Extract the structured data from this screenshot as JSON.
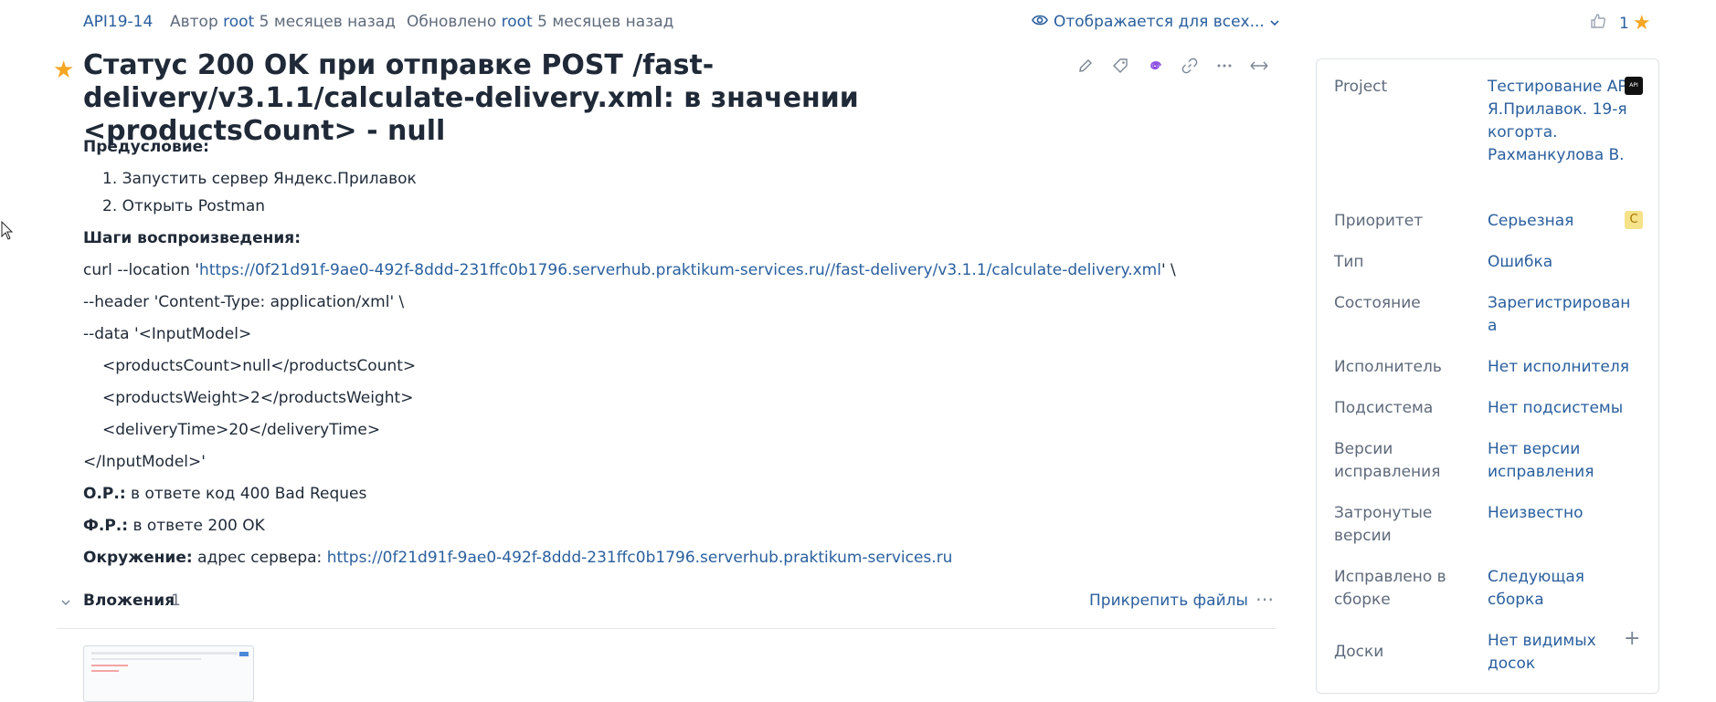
{
  "header": {
    "issue_id": "API19-14",
    "author_prefix": "Автор",
    "author_name": "root",
    "created_time": "5 месяцев назад",
    "updated_prefix": "Обновлено",
    "updated_name": "root",
    "updated_time": "5 месяцев назад",
    "visibility_label": "Отображается для всех...",
    "vote_count": "1"
  },
  "issue": {
    "title": "Статус 200 OK при отправке POST /fast-delivery/v3.1.1/calculate-delivery.xml: в значении <productsCount> - null"
  },
  "description": {
    "precondition_label": "Предусловие:",
    "precondition_steps": [
      "Запустить сервер Яндекс.Прилавок",
      "Открыть Postman"
    ],
    "steps_label": "Шаги воспроизведения:",
    "curl_prefix": "curl --location '",
    "curl_url": "https://0f21d91f-9ae0-492f-8ddd-231ffc0b1796.serverhub.praktikum-services.ru//fast-delivery/v3.1.1/calculate-delivery.xml",
    "curl_suffix": "' \\",
    "header_line": "--header 'Content-Type: application/xml' \\",
    "data_line": "--data '<InputModel>",
    "xml_line1": "<productsCount>null</productsCount>",
    "xml_line2": "<productsWeight>2</productsWeight>",
    "xml_line3": "<deliveryTime>20</deliveryTime>",
    "xml_close": "</InputModel>'",
    "expected_label": "О.Р.:",
    "expected_text": " в ответе код 400 Bad Reques",
    "actual_label": "Ф.Р.:",
    "actual_text": " в ответе 200 OK",
    "env_label": "Окружение:",
    "env_text": " адрес сервера: ",
    "env_url": "https://0f21d91f-9ae0-492f-8ddd-231ffc0b1796.serverhub.praktikum-services.ru"
  },
  "attachments": {
    "label": "Вложения",
    "count": "1",
    "upload_label": "Прикрепить файлы"
  },
  "sidebar": {
    "fields": [
      {
        "label": "Project",
        "value": "Тестирование API Я.Прилавок. 19-я когорта. Рахманкулова В."
      },
      {
        "label": "Приоритет",
        "value": "Серьезная",
        "badge": "С"
      },
      {
        "label": "Тип",
        "value": "Ошибка"
      },
      {
        "label": "Состояние",
        "value": "Зарегистрирован а"
      },
      {
        "label": "Исполнитель",
        "value": "Нет исполнителя"
      },
      {
        "label": "Подсистема",
        "value": "Нет подсистемы"
      },
      {
        "label": "Версии исправления",
        "value": "Нет версии исправления"
      },
      {
        "label": "Затронутые версии",
        "value": "Неизвестно"
      },
      {
        "label": "Исправлено в сборке",
        "value": "Следующая сборка"
      },
      {
        "label": "Доски",
        "value": "Нет видимых досок"
      }
    ],
    "project_avatar_text": "API"
  },
  "icons": [
    "star-icon",
    "eye-icon",
    "chevron-down-icon",
    "thumb-up-icon",
    "pencil-icon",
    "tag-icon",
    "swirl-icon",
    "link-icon",
    "more-icon",
    "expand-icon",
    "plus-icon",
    "cursor-icon"
  ],
  "colors": {
    "accent": "#2a5f9e",
    "star": "#f5a623",
    "priority_badge": "#f5e289"
  }
}
